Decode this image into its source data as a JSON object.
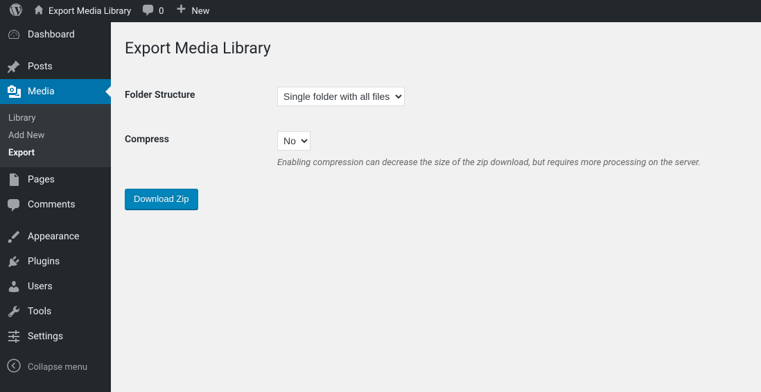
{
  "adminbar": {
    "site_title": "Export Media Library",
    "comments_count": "0",
    "new_label": "New"
  },
  "sidebar": {
    "dashboard": "Dashboard",
    "posts": "Posts",
    "media": "Media",
    "media_sub": {
      "library": "Library",
      "add_new": "Add New",
      "export": "Export"
    },
    "pages": "Pages",
    "comments": "Comments",
    "appearance": "Appearance",
    "plugins": "Plugins",
    "users": "Users",
    "tools": "Tools",
    "settings": "Settings",
    "collapse": "Collapse menu"
  },
  "page": {
    "title": "Export Media Library",
    "folder_structure_label": "Folder Structure",
    "folder_structure_value": "Single folder with all files",
    "compress_label": "Compress",
    "compress_value": "No",
    "compress_desc": "Enabling compression can decrease the size of the zip download, but requires more processing on the server.",
    "submit_label": "Download Zip"
  }
}
